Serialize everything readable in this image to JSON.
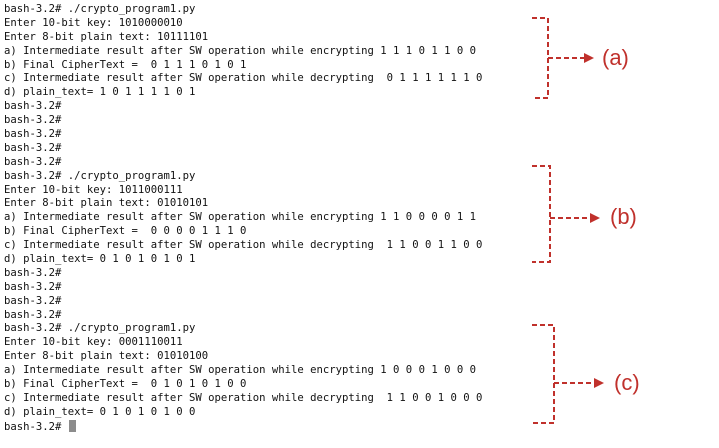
{
  "terminal": {
    "lines": [
      "bash-3.2# ./crypto_program1.py",
      "Enter 10-bit key: 1010000010",
      "Enter 8-bit plain text: 10111101",
      "a) Intermediate result after SW operation while encrypting 1 1 1 0 1 1 0 0",
      "b) Final CipherText =  0 1 1 1 0 1 0 1",
      "c) Intermediate result after SW operation while decrypting  0 1 1 1 1 1 1 0",
      "d) plain_text= 1 0 1 1 1 1 0 1",
      "bash-3.2#",
      "bash-3.2#",
      "bash-3.2#",
      "bash-3.2#",
      "bash-3.2#",
      "bash-3.2# ./crypto_program1.py",
      "Enter 10-bit key: 1011000111",
      "Enter 8-bit plain text: 01010101",
      "a) Intermediate result after SW operation while encrypting 1 1 0 0 0 0 1 1",
      "b) Final CipherText =  0 0 0 0 1 1 1 0",
      "c) Intermediate result after SW operation while decrypting  1 1 0 0 1 1 0 0",
      "d) plain_text= 0 1 0 1 0 1 0 1",
      "bash-3.2#",
      "bash-3.2#",
      "bash-3.2#",
      "bash-3.2#",
      "bash-3.2# ./crypto_program1.py",
      "Enter 10-bit key: 0001110011",
      "Enter 8-bit plain text: 01010100",
      "a) Intermediate result after SW operation while encrypting 1 0 0 0 1 0 0 0",
      "b) Final CipherText =  0 1 0 1 0 1 0 0",
      "c) Intermediate result after SW operation while decrypting  1 1 0 0 1 0 0 0",
      "d) plain_text= 0 1 0 1 0 1 0 0",
      "bash-3.2#"
    ]
  },
  "annotations": [
    {
      "label": "(a)"
    },
    {
      "label": "(b)"
    },
    {
      "label": "(c)"
    }
  ],
  "colors": {
    "annotation": "#c0312c",
    "text": "#111111",
    "cursor": "#8c8c8c"
  }
}
